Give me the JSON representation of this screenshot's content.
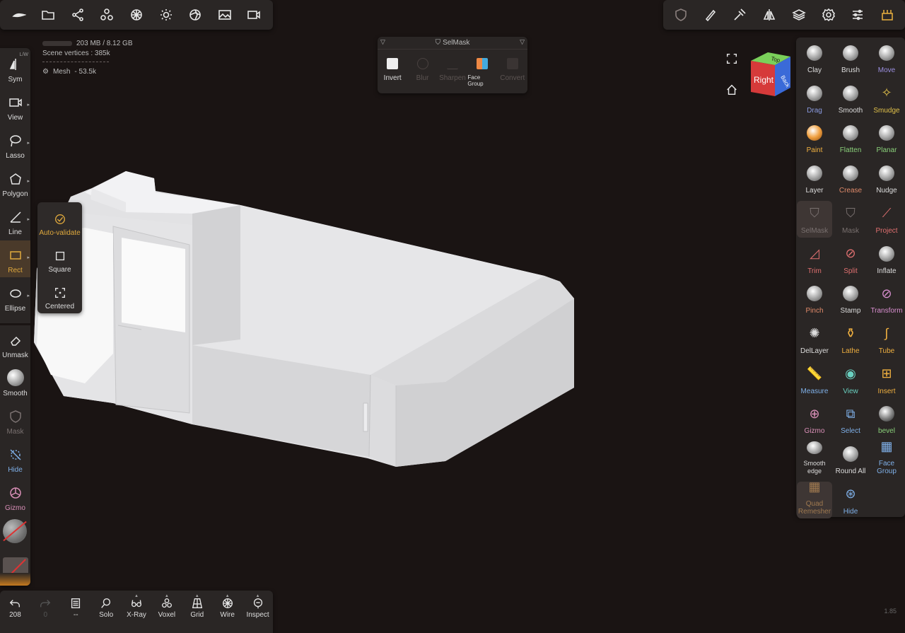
{
  "top_left_toolbar": [
    "logo-icon",
    "folder-icon",
    "share-icon",
    "scene-icon",
    "material-icon",
    "light-icon",
    "postprocess-icon",
    "background-icon",
    "camera-icon"
  ],
  "top_right_toolbar": [
    "selmask-icon",
    "paint-icon",
    "hammer-icon",
    "symmetry-icon",
    "layers-icon",
    "settings-icon",
    "sliders-icon",
    "interface-icon"
  ],
  "stats": {
    "memory": "203 MB / 8.12 GB",
    "vertices": "Scene vertices : 385k",
    "mesh_label": "Mesh",
    "mesh_count": "- 53.5k"
  },
  "left_tools": [
    {
      "label": "Sym",
      "icon": "symmetry-icon",
      "badge": "L/W"
    },
    {
      "label": "View",
      "icon": "camera-icon"
    },
    {
      "label": "Lasso",
      "icon": "lasso-icon"
    },
    {
      "label": "Polygon",
      "icon": "polygon-icon"
    },
    {
      "label": "Line",
      "icon": "line-icon"
    },
    {
      "label": "Rect",
      "icon": "rect-icon"
    },
    {
      "label": "Ellipse",
      "icon": "ellipse-icon"
    }
  ],
  "left_actions": [
    {
      "label": "Unmask",
      "icon": "eraser-icon"
    },
    {
      "label": "Smooth",
      "icon": "smooth-icon"
    },
    {
      "label": "Mask",
      "icon": "mask-icon"
    },
    {
      "label": "Hide",
      "icon": "hide-icon"
    },
    {
      "label": "Gizmo",
      "icon": "gizmo-icon"
    }
  ],
  "flyout": [
    {
      "label": "Auto-validate",
      "icon": "check-circle-icon"
    },
    {
      "label": "Square",
      "icon": "square-icon"
    },
    {
      "label": "Centered",
      "icon": "centered-icon"
    }
  ],
  "selmask": {
    "title": "SelMask",
    "items": [
      {
        "label": "Invert",
        "enabled": true
      },
      {
        "label": "Blur",
        "enabled": false
      },
      {
        "label": "Sharpen",
        "enabled": false
      },
      {
        "label": "Face Group",
        "enabled": true
      },
      {
        "label": "Convert",
        "enabled": false
      }
    ]
  },
  "viewcube": {
    "front": "Right",
    "top": "Top",
    "side": "Back"
  },
  "right_tools": [
    {
      "label": "Clay",
      "color": "#dddddd"
    },
    {
      "label": "Brush",
      "color": "#dddddd"
    },
    {
      "label": "Move",
      "color": "#9b8fe0"
    },
    {
      "label": "Drag",
      "color": "#8a9be0"
    },
    {
      "label": "Smooth",
      "color": "#dddddd"
    },
    {
      "label": "Smudge",
      "color": "#e0c04a"
    },
    {
      "label": "Paint",
      "color": "#f0b040"
    },
    {
      "label": "Flatten",
      "color": "#8ad07a"
    },
    {
      "label": "Planar",
      "color": "#8ad07a"
    },
    {
      "label": "Layer",
      "color": "#dddddd"
    },
    {
      "label": "Crease",
      "color": "#e08a6a"
    },
    {
      "label": "Nudge",
      "color": "#dddddd"
    },
    {
      "label": "SelMask",
      "color": "#7a7170"
    },
    {
      "label": "Mask",
      "color": "#7a7170"
    },
    {
      "label": "Project",
      "color": "#e07070"
    },
    {
      "label": "Trim",
      "color": "#e07070"
    },
    {
      "label": "Split",
      "color": "#e07070"
    },
    {
      "label": "Inflate",
      "color": "#dddddd"
    },
    {
      "label": "Pinch",
      "color": "#e08a6a"
    },
    {
      "label": "Stamp",
      "color": "#dddddd"
    },
    {
      "label": "Transform",
      "color": "#d98fd0"
    },
    {
      "label": "DelLayer",
      "color": "#dddddd"
    },
    {
      "label": "Lathe",
      "color": "#f0b040"
    },
    {
      "label": "Tube",
      "color": "#f0b040"
    },
    {
      "label": "Measure",
      "color": "#7fb0e8"
    },
    {
      "label": "View",
      "color": "#6ad0c0"
    },
    {
      "label": "Insert",
      "color": "#f0b040"
    },
    {
      "label": "Gizmo",
      "color": "#d98fb7"
    },
    {
      "label": "Select",
      "color": "#7fb0e8"
    },
    {
      "label": "bevel",
      "color": "#8ad07a"
    },
    {
      "label": "Smooth edge",
      "color": "#dddddd"
    },
    {
      "label": "Round All",
      "color": "#dddddd"
    },
    {
      "label": "Face Group",
      "color": "#7fb0e8"
    },
    {
      "label": "Quad Remesher",
      "color": "#a07a50"
    },
    {
      "label": "Hide",
      "color": "#7fb0e8"
    }
  ],
  "bottom_tools": [
    {
      "label": "208",
      "icon": "undo-icon"
    },
    {
      "label": "0",
      "icon": "redo-icon"
    },
    {
      "label": "--",
      "icon": "history-icon"
    },
    {
      "label": "Solo",
      "icon": "solo-icon"
    },
    {
      "label": "X-Ray",
      "icon": "xray-icon"
    },
    {
      "label": "Voxel",
      "icon": "voxel-icon"
    },
    {
      "label": "Grid",
      "icon": "grid-icon"
    },
    {
      "label": "Wire",
      "icon": "wire-icon"
    },
    {
      "label": "Inspect",
      "icon": "inspect-icon"
    }
  ],
  "version": "1.85"
}
